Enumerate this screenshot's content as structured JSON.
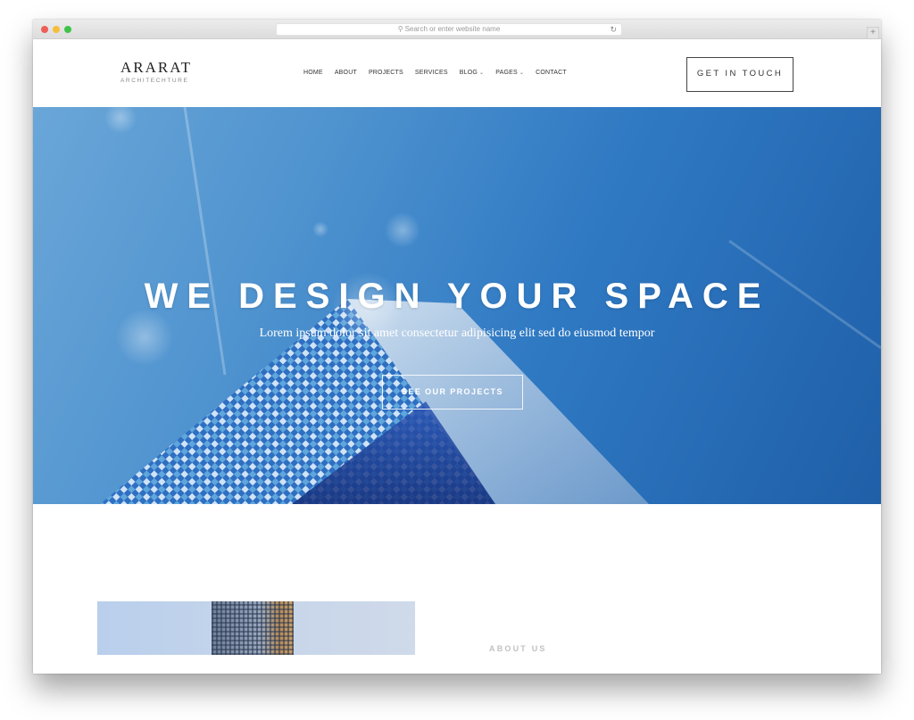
{
  "browser": {
    "address_placeholder": "Search or enter website name",
    "search_icon": "magnifier-icon",
    "reload_icon": "reload-icon",
    "new_tab_icon": "plus-icon"
  },
  "header": {
    "logo_title": "ARARAT",
    "logo_subtitle": "ARCHITECHTURE",
    "nav": [
      {
        "label": "HOME"
      },
      {
        "label": "ABOUT"
      },
      {
        "label": "PROJECTS"
      },
      {
        "label": "SERVICES"
      },
      {
        "label": "BLOG",
        "dropdown": true
      },
      {
        "label": "PAGES",
        "dropdown": true
      },
      {
        "label": "CONTACT"
      }
    ],
    "cta_label": "GET IN TOUCH"
  },
  "hero": {
    "title": "WE DESIGN YOUR SPACE",
    "subtitle": "Lorem ipsum dolor sit amet consectetur adipisicing elit sed do eiusmod tempor",
    "button_label": "SEE OUR PROJECTS"
  },
  "about": {
    "label": "ABOUT US"
  },
  "colors": {
    "sky_light": "#6aa6d8",
    "sky_dark": "#1f5fa8",
    "text_dark": "#222222",
    "muted": "#c2c2c2"
  }
}
